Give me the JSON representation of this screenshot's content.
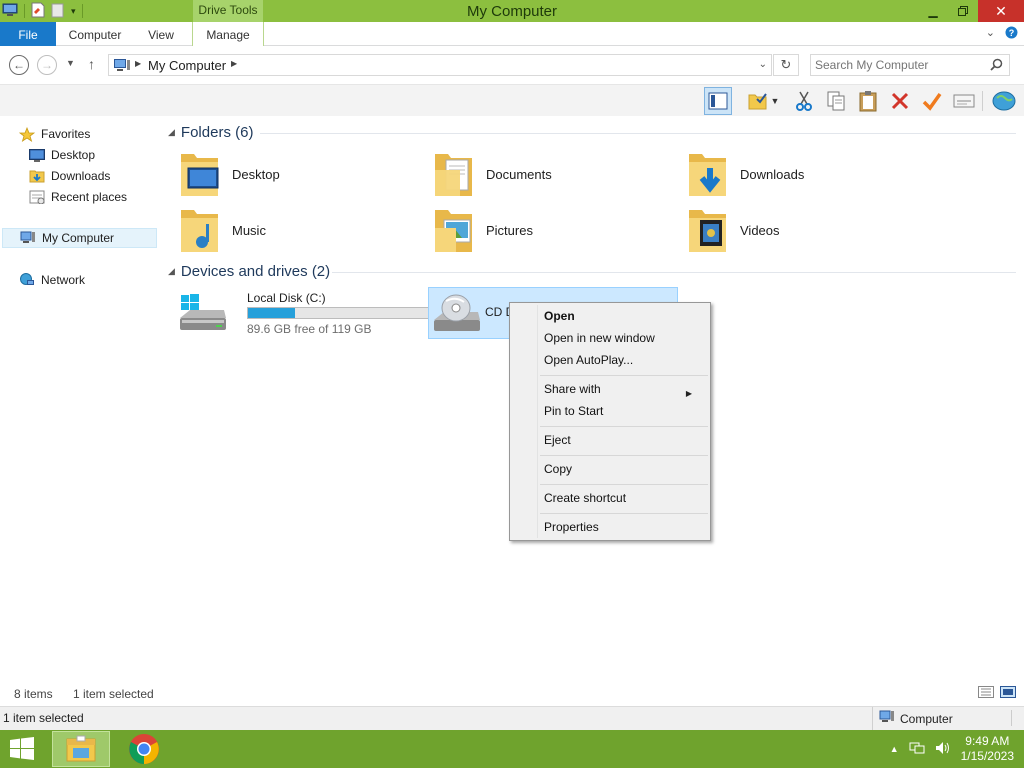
{
  "window": {
    "title": "My Computer",
    "contextual_tab_group": "Drive Tools",
    "accent_color": "#8cbf3f",
    "minimize_icon": "minimize-icon",
    "maximize_icon": "restore-icon",
    "close_icon": "close-icon"
  },
  "ribbon": {
    "tabs": [
      "File",
      "Computer",
      "View",
      "Manage"
    ],
    "file_tab_color": "#1979ca"
  },
  "address": {
    "path": "My Computer",
    "search_placeholder": "Search My Computer"
  },
  "nav_pane": {
    "favorites": "Favorites",
    "items": [
      "Desktop",
      "Downloads",
      "Recent places"
    ],
    "computer": "My Computer",
    "network": "Network"
  },
  "folders": {
    "header": "Folders (6)",
    "items": [
      "Desktop",
      "Documents",
      "Downloads",
      "Music",
      "Pictures",
      "Videos"
    ]
  },
  "drives": {
    "header": "Devices and drives (2)",
    "local": {
      "label": "Local Disk (C:)",
      "free_text": "89.6 GB free of 119 GB",
      "used_fraction": 0.25
    },
    "cd": {
      "label": "CD D"
    }
  },
  "context_menu": {
    "items": [
      "Open",
      "Open in new window",
      "Open AutoPlay...",
      "Share with",
      "Pin to Start",
      "Eject",
      "Copy",
      "Create shortcut",
      "Properties"
    ]
  },
  "status": {
    "item_count": "8 items",
    "selected": "1 item selected"
  },
  "infobar": {
    "left": "1 item selected",
    "zone": "Computer"
  },
  "taskbar": {
    "time": "9:49 AM",
    "date": "1/15/2023",
    "color": "#6fa32d"
  }
}
